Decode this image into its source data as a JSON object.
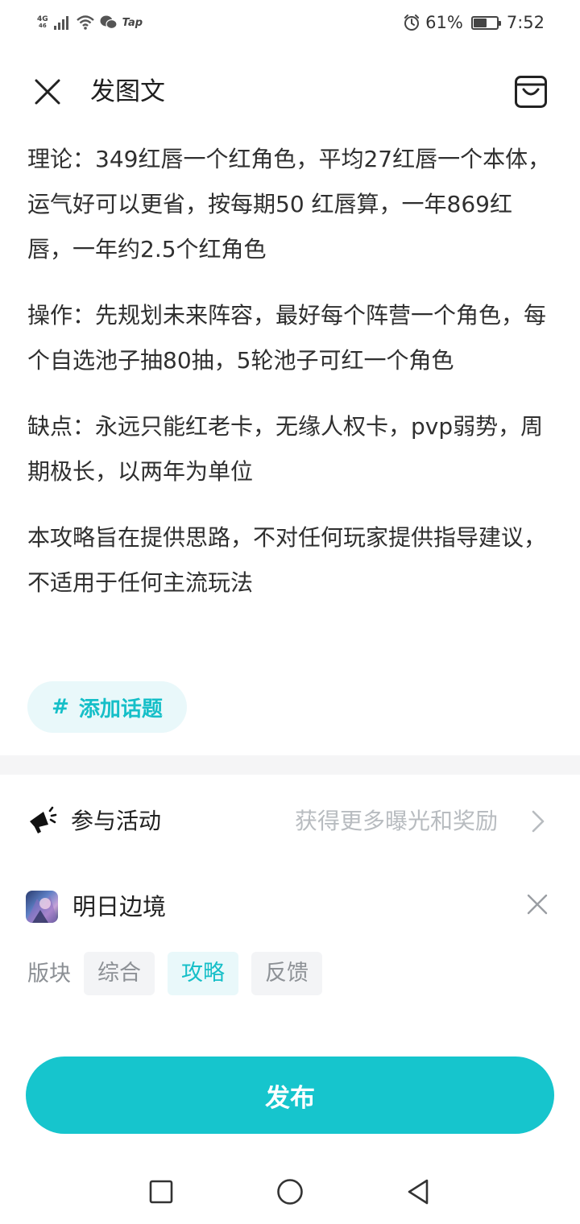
{
  "status": {
    "network": "4G",
    "network_sub": "46",
    "app_badge": "Tap",
    "battery_percent": "61%",
    "battery_level": 0.61,
    "time": "7:52"
  },
  "header": {
    "title": "发图文"
  },
  "content": {
    "paragraphs": [
      "理论：349红唇一个红角色，平均27红唇一个本体，运气好可以更省，按每期50 红唇算，一年869红唇，一年约2.5个红角色",
      "操作：先规划未来阵容，最好每个阵营一个角色，每个自选池子抽80抽，5轮池子可红一个角色",
      "缺点：永远只能红老卡，无缘人权卡，pvp弱势，周期极长，以两年为单位",
      "本攻略旨在提供思路，不对任何玩家提供指导建议，不适用于任何主流玩法"
    ]
  },
  "topic": {
    "hash": "#",
    "label": "添加话题"
  },
  "activity": {
    "label": "参与活动",
    "hint": "获得更多曝光和奖励"
  },
  "game": {
    "name": "明日边境"
  },
  "section": {
    "label": "版块",
    "chips": [
      {
        "label": "综合",
        "active": false
      },
      {
        "label": "攻略",
        "active": true
      },
      {
        "label": "反馈",
        "active": false
      }
    ]
  },
  "publish": {
    "label": "发布"
  },
  "colors": {
    "accent": "#16c5cd",
    "accent_light": "#e9f8fa",
    "text": "#2f2f2f",
    "hint": "#b8bcc0"
  },
  "icons": [
    "close-icon",
    "bag-icon",
    "megaphone-icon",
    "chevron-right-icon",
    "game-logo-icon",
    "remove-icon",
    "nav-recent-icon",
    "nav-home-icon",
    "nav-back-icon",
    "alarm-icon",
    "wifi-icon",
    "wechat-icon",
    "signal-icon",
    "battery-icon"
  ]
}
